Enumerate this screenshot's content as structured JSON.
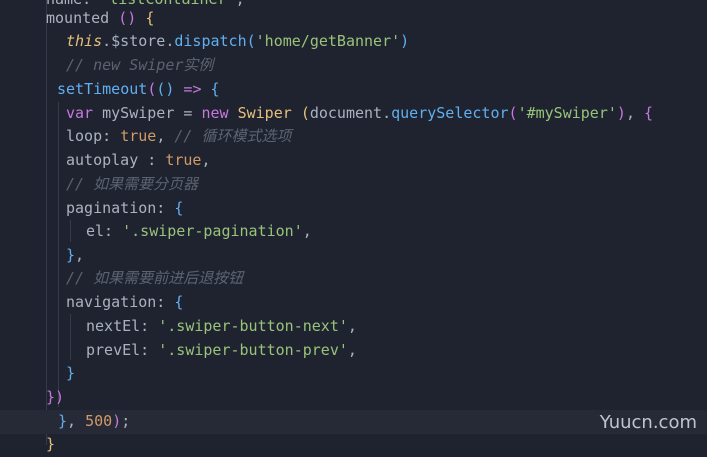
{
  "watermark": "Yuucn.com",
  "lines": [
    [
      [
        "tok-key",
        "name: "
      ],
      [
        "tok-str",
        "'listContainer'"
      ],
      [
        "tok-punct",
        ","
      ]
    ],
    [
      [
        "tok-key",
        "mounted "
      ],
      [
        "tok-b2",
        "()"
      ],
      [
        "tok-punct",
        " "
      ],
      [
        "tok-b1",
        "{"
      ]
    ],
    [
      [
        "tok-this",
        "this"
      ],
      [
        "tok-punct",
        "."
      ],
      [
        "tok-key",
        "$store"
      ],
      [
        "tok-punct",
        "."
      ],
      [
        "tok-fn",
        "dispatch"
      ],
      [
        "tok-b3",
        "("
      ],
      [
        "tok-str",
        "'home/getBanner'"
      ],
      [
        "tok-b3",
        ")"
      ]
    ],
    [
      [
        "tok-cm",
        "// new Swiper实例"
      ]
    ],
    [
      [
        "tok-fn",
        "setTimeout"
      ],
      [
        "tok-b2",
        "("
      ],
      [
        "tok-b3",
        "()"
      ],
      [
        "tok-kw",
        " => "
      ],
      [
        "tok-b3",
        "{"
      ]
    ],
    [
      [
        "tok-kw",
        "var "
      ],
      [
        "tok-key",
        "mySwiper "
      ],
      [
        "tok-punct",
        "= "
      ],
      [
        "tok-kw",
        "new "
      ],
      [
        "tok-fn-y",
        "Swiper "
      ],
      [
        "tok-b1",
        "("
      ],
      [
        "tok-key",
        "document"
      ],
      [
        "tok-punct",
        "."
      ],
      [
        "tok-fn",
        "querySelector"
      ],
      [
        "tok-b2",
        "("
      ],
      [
        "tok-str",
        "'#mySwiper'"
      ],
      [
        "tok-b2",
        ")"
      ],
      [
        "tok-punct",
        ", "
      ],
      [
        "tok-b2",
        "{"
      ]
    ],
    [
      [
        "tok-key",
        "loop: "
      ],
      [
        "tok-num",
        "true"
      ],
      [
        "tok-punct",
        ", "
      ],
      [
        "tok-cm",
        "// 循环模式选项"
      ]
    ],
    [
      [
        "tok-key",
        "autoplay : "
      ],
      [
        "tok-num",
        "true"
      ],
      [
        "tok-punct",
        ","
      ]
    ],
    [
      [
        "tok-cm",
        "// 如果需要分页器"
      ]
    ],
    [
      [
        "tok-key",
        "pagination: "
      ],
      [
        "tok-b3",
        "{"
      ]
    ],
    [
      [
        "tok-key",
        "el: "
      ],
      [
        "tok-str",
        "'.swiper-pagination'"
      ],
      [
        "tok-punct",
        ","
      ]
    ],
    [
      [
        "tok-b3",
        "}"
      ],
      [
        "tok-punct",
        ","
      ]
    ],
    [
      [
        "tok-cm",
        "// 如果需要前进后退按钮"
      ]
    ],
    [
      [
        "tok-key",
        "navigation: "
      ],
      [
        "tok-b3",
        "{"
      ]
    ],
    [
      [
        "tok-key",
        "nextEl: "
      ],
      [
        "tok-str",
        "'.swiper-button-next'"
      ],
      [
        "tok-punct",
        ","
      ]
    ],
    [
      [
        "tok-key",
        "prevEl: "
      ],
      [
        "tok-str",
        "'.swiper-button-prev'"
      ],
      [
        "tok-punct",
        ","
      ]
    ],
    [
      [
        "tok-b3",
        "}"
      ]
    ],
    [
      [
        "tok-b2",
        "})"
      ]
    ],
    [
      [
        "tok-b3",
        "}"
      ],
      [
        "tok-punct",
        ", "
      ],
      [
        "tok-num",
        "500"
      ],
      [
        "tok-b2",
        ")"
      ],
      [
        "tok-punct",
        ";"
      ]
    ],
    [
      [
        "tok-b1",
        "}"
      ]
    ]
  ]
}
